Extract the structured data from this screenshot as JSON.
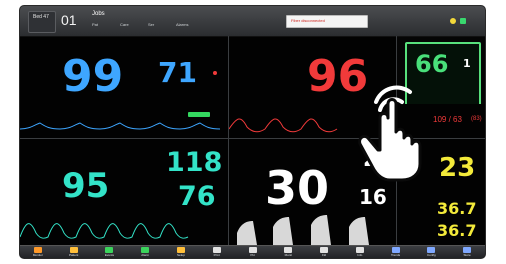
{
  "header": {
    "bed_label": "Bed 47",
    "bed_number": "01",
    "patient_name": "Jobs",
    "alarm_text": "Fiber disconnected",
    "tiny_labels": [
      "Pat",
      "Care",
      "Ser",
      "Alarms"
    ]
  },
  "vitals": {
    "hr": "99",
    "spo2_small": "71",
    "red_big": "96",
    "green_big": "66",
    "green_small": "1",
    "nbp": "109 / 63",
    "nbp_extra": "(83)",
    "cyan_big": "95",
    "cyan_top": "118",
    "cyan_bottom": "76",
    "white_big": "30",
    "white_top": "2",
    "white_bottom": "16",
    "yellow_big": "23",
    "temp1": "36.7",
    "temp2": "36.7"
  },
  "toolbar": {
    "buttons": [
      {
        "label": "Monitor",
        "icon": "monitor-icon",
        "color": "#ff9a2a"
      },
      {
        "label": "Patient",
        "icon": "patient-icon",
        "color": "#ffbf3a"
      },
      {
        "label": "Events",
        "icon": "events-icon",
        "color": "#3bd45c"
      },
      {
        "label": "Alarm",
        "icon": "alarm-icon",
        "color": "#3bd45c"
      },
      {
        "label": "Setup",
        "icon": "setup-icon",
        "color": "#ffbf3a"
      },
      {
        "label": "Print",
        "icon": "print-icon",
        "color": "#e2e2e2"
      },
      {
        "label": "Pkt",
        "icon": "pkt-icon",
        "color": "#e2e2e2"
      },
      {
        "label": "Monit",
        "icon": "monit-icon",
        "color": "#e2e2e2"
      },
      {
        "label": "Fld",
        "icon": "fld-icon",
        "color": "#e2e2e2"
      },
      {
        "label": "Info",
        "icon": "info-icon",
        "color": "#e2e2e2"
      },
      {
        "label": "Trends",
        "icon": "trends-icon",
        "color": "#7fa8ff"
      },
      {
        "label": "Config",
        "icon": "config-icon",
        "color": "#7fa8ff"
      },
      {
        "label": "Store",
        "icon": "store-icon",
        "color": "#7fa8ff"
      }
    ]
  }
}
